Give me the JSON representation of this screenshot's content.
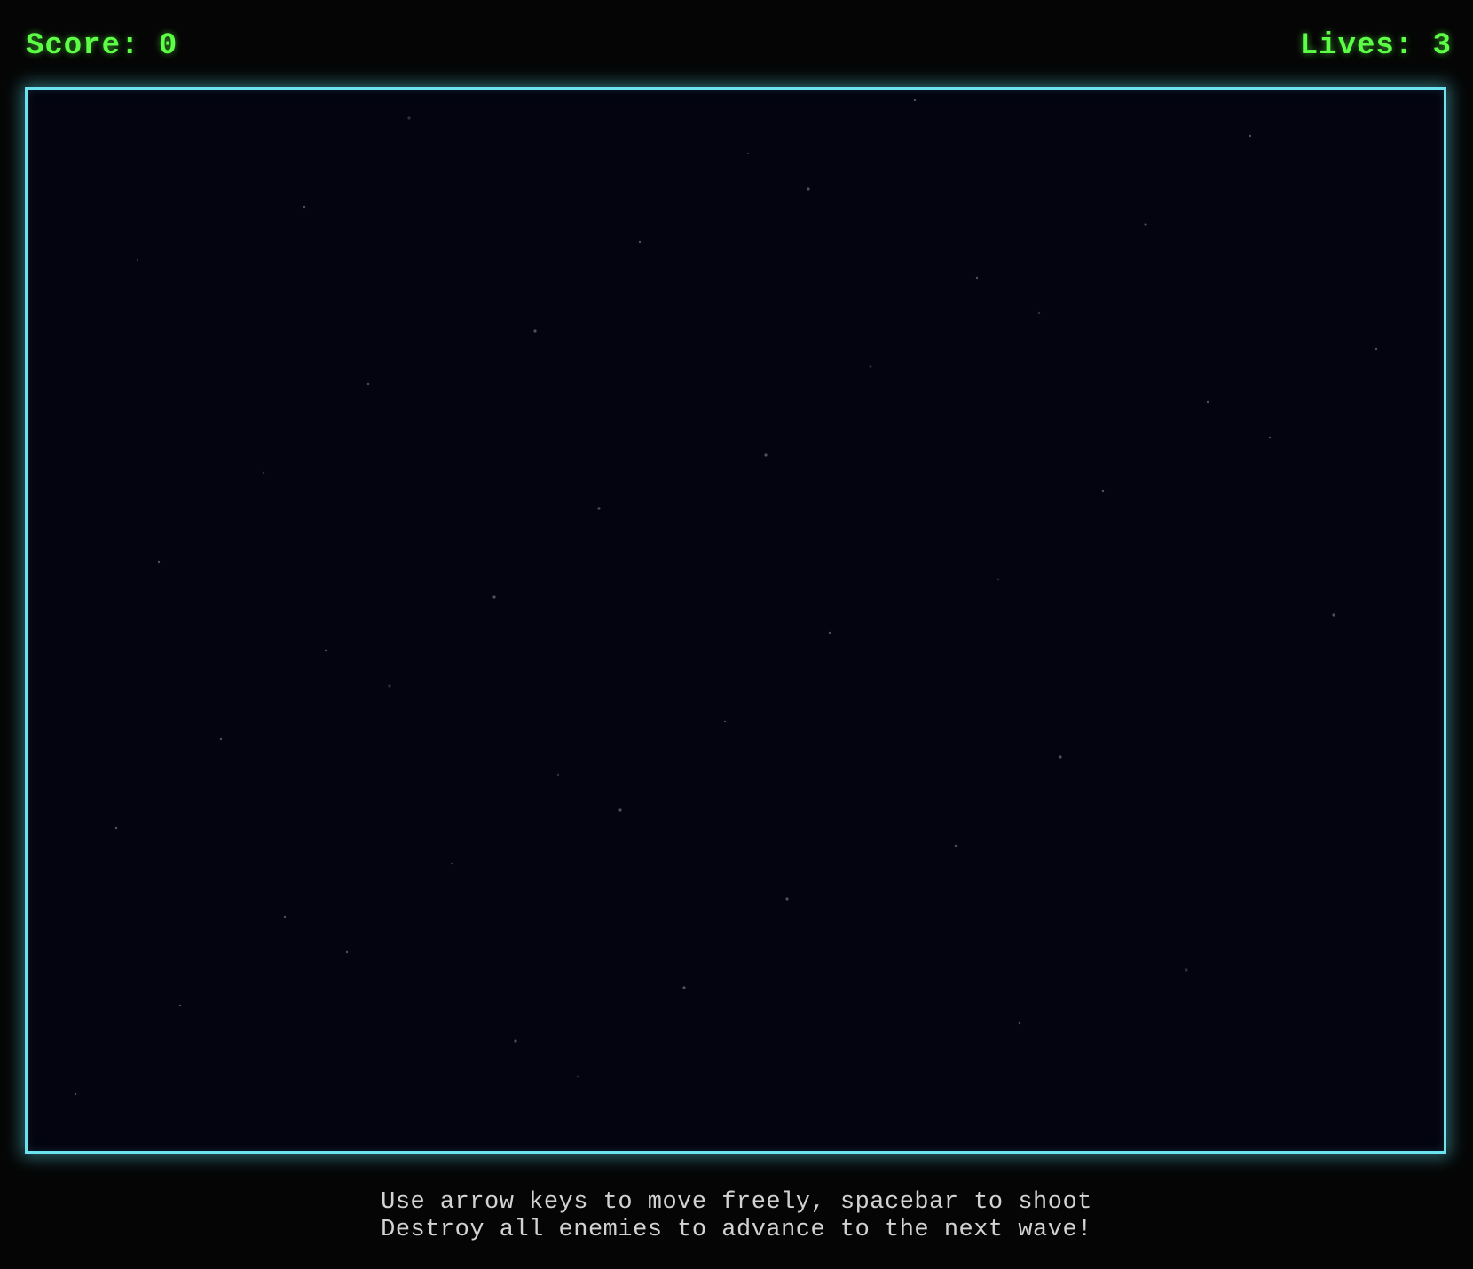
{
  "hud": {
    "score": "Score: 0",
    "lives": "Lives: 3"
  },
  "game_area": {
    "background_color": "#03040f",
    "border_color": "#6ae2f0",
    "star_count": 46
  },
  "instructions": {
    "line1": "Use arrow keys to move freely, spacebar to shoot",
    "line2": "Destroy all enemies to advance to the next wave!"
  },
  "colors": {
    "hud_text": "#5cff45",
    "instruction_text": "#d2d2d2"
  }
}
